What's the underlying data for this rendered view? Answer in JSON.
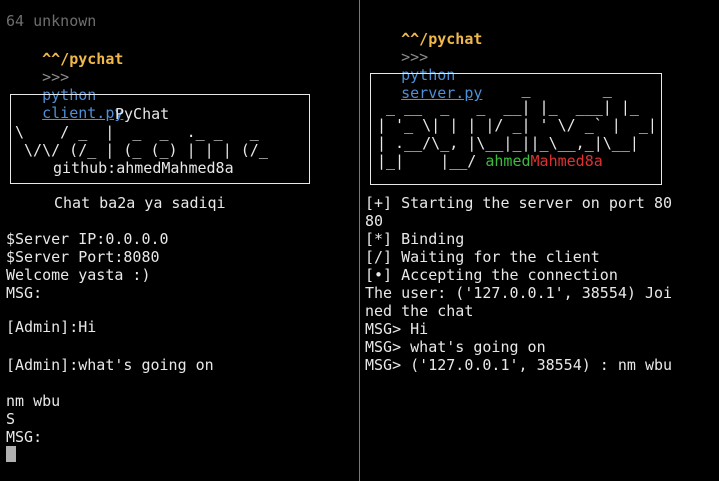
{
  "left": {
    "status_line": "64 unknown",
    "prompt": {
      "dir": "^^/pychat",
      "arrow": ">>>",
      "command": "python",
      "argument": "client.py"
    },
    "banner": {
      "title": "PyChat",
      "art_1": "\\    / _  |  _  _  ._ _   _",
      "art_2": " \\/\\/ (/_ | (_ (_) | | | (/_",
      "github": "github:ahmedMahmed8a"
    },
    "output": [
      "Chat ba2a ya sadiqi",
      "$Server IP:0.0.0.0",
      "$Server Port:8080",
      "Welcome yasta :)",
      "MSG:",
      "[Admin]:Hi",
      "[Admin]:what's going on",
      "nm wbu",
      "S",
      "MSG:"
    ]
  },
  "right": {
    "prompt": {
      "dir": "^^/pychat",
      "arrow": ">>>",
      "command": "python",
      "argument": "server.py"
    },
    "banner": {
      "art_0": "                _        _",
      "art_1": " _ __  _   _  __| |_  ___| |_",
      "art_2": "| '_ \\| | | |/ _| ' \\/ _` |  _|",
      "art_3": "| .__/\\_, |\\__|_||_\\__,_|\\__|",
      "art_4_prefix": "|_|    |__/ ",
      "github_part_1": "ahmed",
      "github_part_2": "Mahmed8a"
    },
    "output": [
      "[+] Starting the server on port 80",
      "80",
      "[*] Binding",
      "[/] Waiting for the client",
      "[•] Accepting the connection",
      "The user: ('127.0.0.1', 38554) Joi",
      "ned the chat",
      "MSG> Hi",
      "MSG> what's going on",
      "MSG> ('127.0.0.1', 38554) : nm wbu"
    ]
  },
  "colors": {
    "background": "#000000",
    "text": "#e8e8e8",
    "prompt_dir": "#f0b84a",
    "command": "#4f8fd6",
    "divider": "#3aa04a",
    "github_green": "#3dbb3d",
    "github_red": "#e03030"
  }
}
